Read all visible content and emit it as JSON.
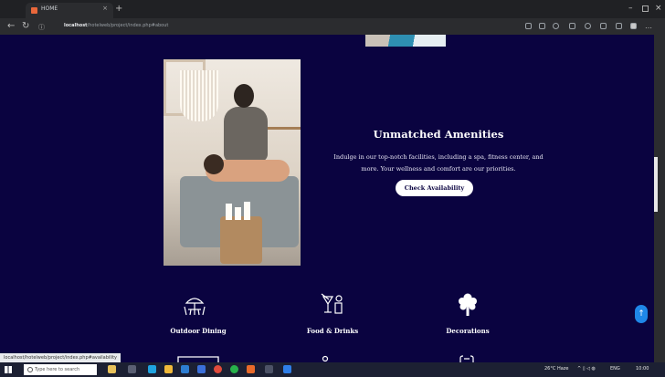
{
  "browser": {
    "tab_title": "HOME",
    "tab_close": "×",
    "new_tab": "+",
    "url_host": "localhost",
    "url_path": "/hotelweb/project/index.php#about",
    "window_controls": {
      "minimize": "–",
      "close": "×"
    }
  },
  "amenities_section": {
    "heading": "Unmatched Amenities",
    "description": "Indulge in our top-notch facilities, including a spa, fitness center, and more. Your wellness and comfort are our priorities.",
    "cta": "Check Availability"
  },
  "amenities": [
    {
      "label": "Outdoor Dining",
      "icon": "outdoor-dining-icon"
    },
    {
      "label": "Food & Drinks",
      "icon": "cocktail-icon"
    },
    {
      "label": "Decorations",
      "icon": "decoration-icon"
    }
  ],
  "scroll_top": "↑",
  "status_link": "localhost/hotelweb/project/index.php#availability",
  "taskbar": {
    "search_placeholder": "Type here to search",
    "weather": "26°C Haze",
    "language": "ENG",
    "time": "10:00"
  },
  "colors": {
    "page_bg": "#0a0340",
    "accent": "#ffffff",
    "fab": "#1f87e8"
  }
}
